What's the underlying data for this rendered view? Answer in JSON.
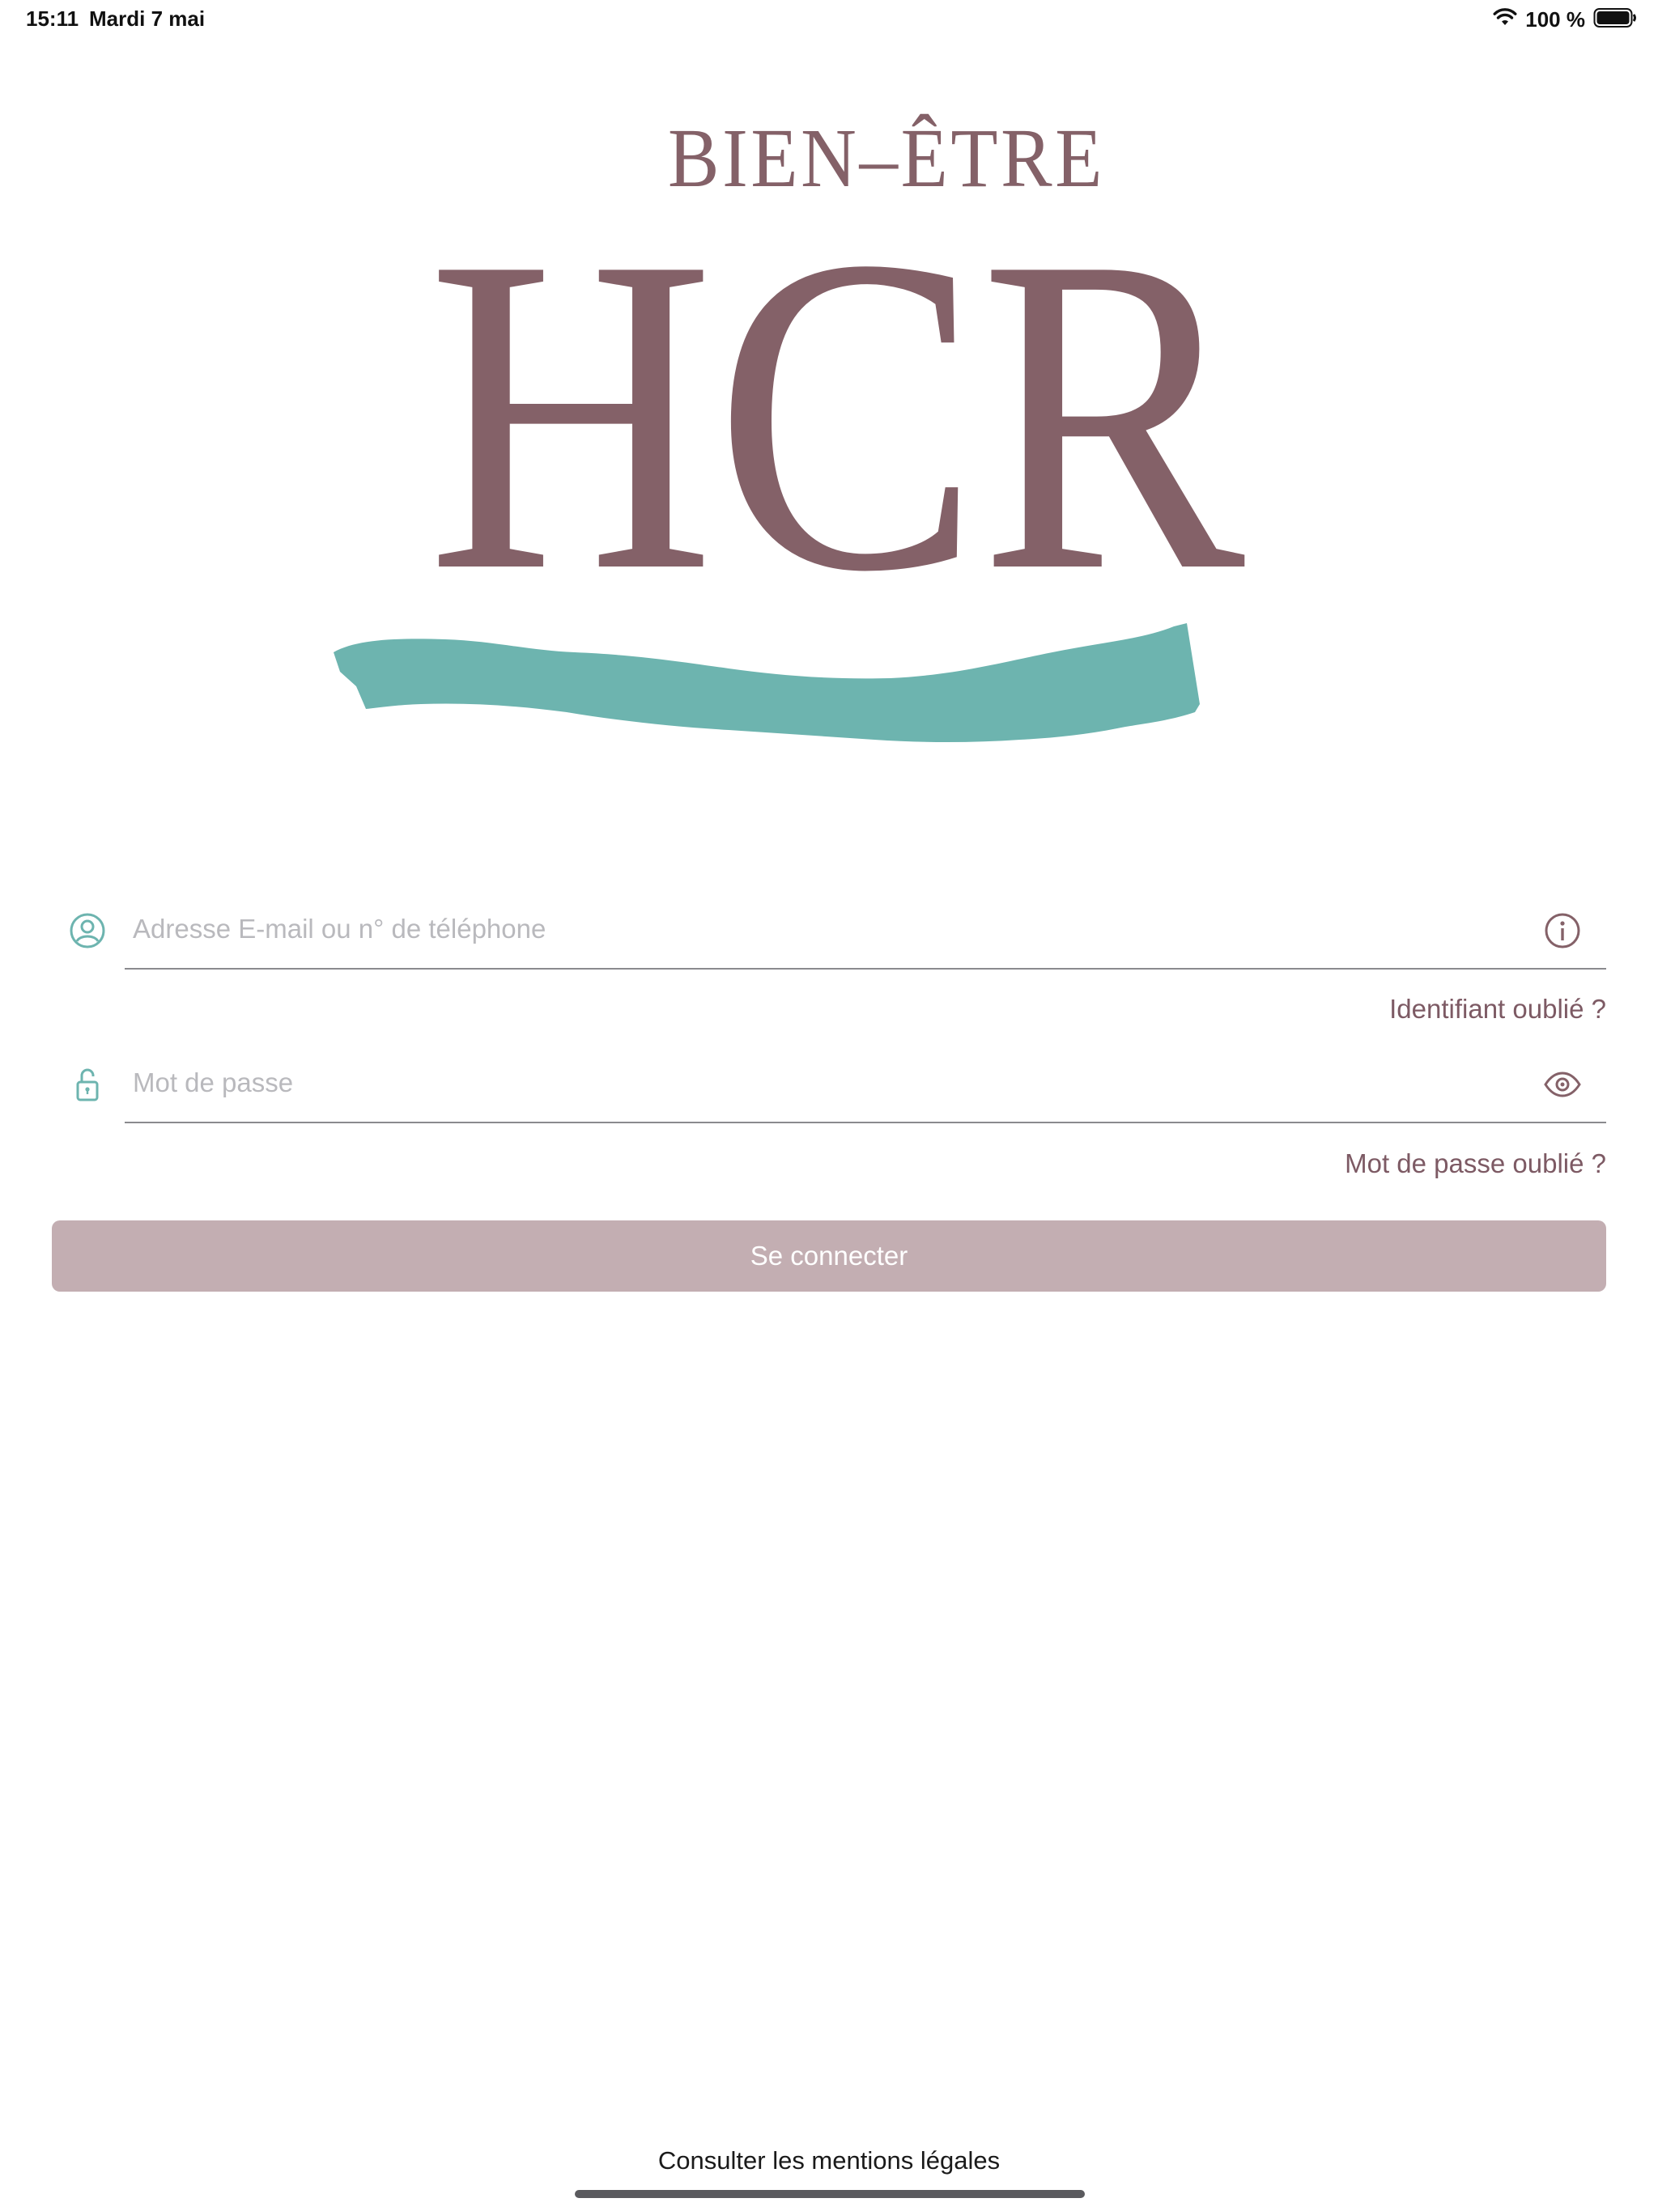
{
  "status_bar": {
    "time": "15:11",
    "date": "Mardi 7 mai",
    "battery": "100 %",
    "icons": [
      "wifi-icon",
      "battery-icon"
    ]
  },
  "logo": {
    "tagline": "BIEN-ÊTRE",
    "wordmark": "HCR",
    "colors": {
      "wordmark": "#846168",
      "brush_stroke": "#6db4af"
    }
  },
  "login_form": {
    "identifier": {
      "placeholder": "Adresse E-mail ou n° de téléphone",
      "value": "",
      "leading_icon": "user-circle-icon",
      "trailing_icon": "info-icon"
    },
    "forgot_identifier": "Identifiant oublié ?",
    "password": {
      "placeholder": "Mot de passe",
      "value": "",
      "leading_icon": "lock-icon",
      "trailing_icon": "eye-icon"
    },
    "forgot_password": "Mot de passe oublié ?",
    "submit_label": "Se connecter"
  },
  "footer": {
    "legal_link": "Consulter les mentions légales"
  },
  "colors": {
    "accent_teal": "#6db4af",
    "accent_mauve": "#846168",
    "link": "#7d5a64",
    "button_disabled": "#c3aeb2",
    "button_text": "#ffffff",
    "placeholder": "#b9b9bd"
  }
}
